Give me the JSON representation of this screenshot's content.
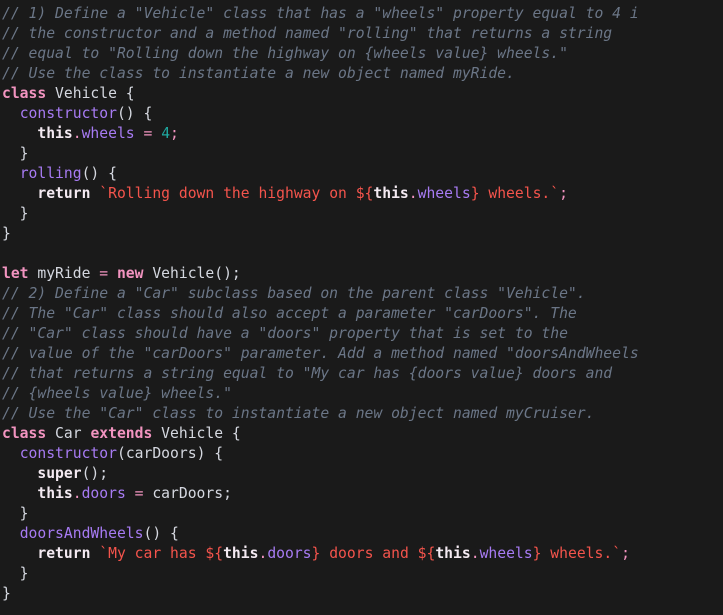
{
  "editor": {
    "language": "javascript",
    "background_color": "#1a1a1a",
    "font_size_px": 14.7,
    "line_height_px": 20,
    "theme": {
      "comment_color": "#6b7687",
      "keyword_color": "#f294c0",
      "function_color": "#a77bf3",
      "property_color": "#a77bf3",
      "string_color": "#f4544c",
      "number_color": "#1fa8a0",
      "identifier_color": "#d5d8e0",
      "this_color": "#f4eaf2"
    }
  },
  "code": {
    "lines": [
      "// 1) Define a \"Vehicle\" class that has a \"wheels\" property equal to 4 i",
      "// the constructor and a method named \"rolling\" that returns a string",
      "// equal to \"Rolling down the highway on {wheels value} wheels.\"",
      "// Use the class to instantiate a new object named myRide.",
      "class Vehicle {",
      "  constructor() {",
      "    this.wheels = 4;",
      "  }",
      "  rolling() {",
      "    return `Rolling down the highway on ${this.wheels} wheels.`;",
      "  }",
      "}",
      "",
      "let myRide = new Vehicle();",
      "// 2) Define a \"Car\" subclass based on the parent class \"Vehicle\".",
      "// The \"Car\" class should also accept a parameter \"carDoors\". The",
      "// \"Car\" class should have a \"doors\" property that is set to the",
      "// value of the \"carDoors\" parameter. Add a method named \"doorsAndWheels",
      "// that returns a string equal to \"My car has {doors value} doors and",
      "// {wheels value} wheels.\"",
      "// Use the \"Car\" class to instantiate a new object named myCruiser.",
      "class Car extends Vehicle {",
      "  constructor(carDoors) {",
      "    super();",
      "    this.doors = carDoors;",
      "  }",
      "  doorsAndWheels() {",
      "    return `My car has ${this.doors} doors and ${this.wheels} wheels.`;",
      "  }",
      "}"
    ],
    "tokens": {
      "comment_1_1": "// 1) Define a \"Vehicle\" class that has a \"wheels\" property equal to 4 i",
      "comment_1_2": "// the constructor and a method named \"rolling\" that returns a string",
      "comment_1_3": "// equal to \"Rolling down the highway on {wheels value} wheels.\"",
      "comment_1_4": "// Use the class to instantiate a new object named myRide.",
      "kw_class_a": "class",
      "name_vehicle_a": " Vehicle {",
      "kw_constructor_a": "constructor",
      "paren_constructor_a": "() {",
      "kw_this_a": "this",
      "dot_a": ".",
      "prop_wheels_a": "wheels",
      "eq_a": " = ",
      "num_four": "4",
      "semi_a": ";",
      "close_brace_inner_a": "  }",
      "fn_rolling": "rolling",
      "paren_rolling": "() {",
      "kw_return_a": "return",
      "str_rolling_open": " `Rolling down the highway on ",
      "interp_open_a": "${",
      "kw_this_b": "this",
      "dot_b": ".",
      "prop_wheels_b": "wheels",
      "interp_close_a": "}",
      "str_rolling_close": " wheels.`",
      "semi_b": ";",
      "close_brace_inner_b": "  }",
      "close_brace_outer_a": "}",
      "kw_let": "let",
      "name_myride": " myRide ",
      "eq_b": "=",
      "kw_new": " new",
      "name_vehicle_call": " Vehicle();",
      "comment_2_1": "// 2) Define a \"Car\" subclass based on the parent class \"Vehicle\".",
      "comment_2_2": "// The \"Car\" class should also accept a parameter \"carDoors\". The",
      "comment_2_3": "// \"Car\" class should have a \"doors\" property that is set to the",
      "comment_2_4": "// value of the \"carDoors\" parameter. Add a method named \"doorsAndWheels",
      "comment_2_5": "// that returns a string equal to \"My car has {doors value} doors and",
      "comment_2_6": "// {wheels value} wheels.\"",
      "comment_2_7": "// Use the \"Car\" class to instantiate a new object named myCruiser.",
      "kw_class_b": "class",
      "name_car": " Car ",
      "kw_extends": "extends",
      "name_vehicle_b": " Vehicle {",
      "kw_constructor_b": "constructor",
      "paren_constructor_b": "(",
      "param_cardoors": "carDoors",
      "paren_constructor_b_close": ") {",
      "kw_super": "super",
      "paren_super": "();",
      "kw_this_c": "this",
      "dot_c": ".",
      "prop_doors_a": "doors",
      "eq_c": " = ",
      "name_cardoors_val": "carDoors;",
      "close_brace_inner_c": "  }",
      "fn_doorsandwheels": "doorsAndWheels",
      "paren_doorsandwheels": "() {",
      "kw_return_b": "return",
      "str_mycar_open": " `My car has ",
      "interp_open_b": "${",
      "kw_this_d": "this",
      "dot_d": ".",
      "prop_doors_b": "doors",
      "interp_close_b": "}",
      "str_doors_and": " doors and ",
      "interp_open_c": "${",
      "kw_this_e": "this",
      "dot_e": ".",
      "prop_wheels_c": "wheels",
      "interp_close_c": "}",
      "str_mycar_close": " wheels.`",
      "semi_c": ";",
      "close_brace_inner_d": "  }",
      "close_brace_outer_b": "}"
    }
  }
}
